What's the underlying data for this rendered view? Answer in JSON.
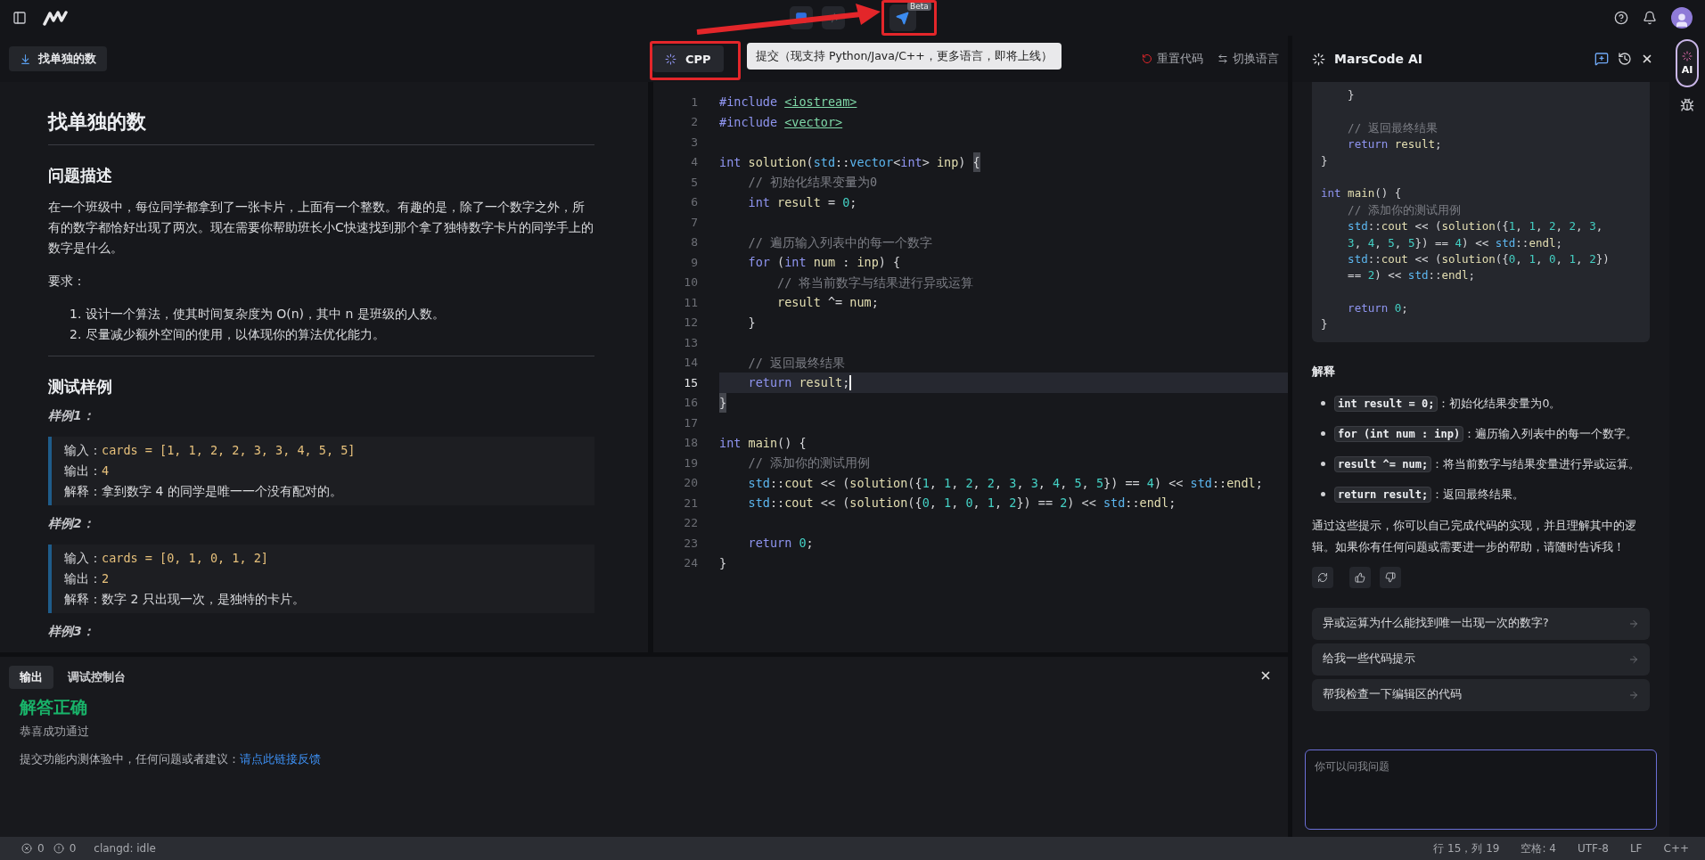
{
  "top_bar": {
    "submit_badge": "Beta"
  },
  "tooltip": {
    "text": "提交（现支持 Python/Java/C++，更多语言，即将上线）"
  },
  "problem_tab": {
    "label": "找单独的数"
  },
  "language_button": {
    "label": "CPP"
  },
  "editor_actions": [
    {
      "kind": "reset",
      "label": "重置代码"
    },
    {
      "kind": "switch",
      "label": "切换语言"
    }
  ],
  "problem": {
    "title": "找单独的数",
    "sections": [
      {
        "kind": "heading",
        "text": "问题描述"
      },
      {
        "kind": "paragraph",
        "text": "在一个班级中，每位同学都拿到了一张卡片，上面有一个整数。有趣的是，除了一个数字之外，所有的数字都恰好出现了两次。现在需要你帮助班长小C快速找到那个拿了独特数字卡片的同学手上的数字是什么。"
      },
      {
        "kind": "paragraph",
        "text": "要求："
      },
      {
        "kind": "list",
        "items": [
          {
            "number": "1.",
            "text": "设计一个算法，使其时间复杂度为 O(n)，其中 n 是班级的人数。"
          },
          {
            "number": "2.",
            "text": "尽量减少额外空间的使用，以体现你的算法优化能力。"
          }
        ]
      },
      {
        "kind": "rule"
      },
      {
        "kind": "heading",
        "text": "测试样例"
      },
      {
        "kind": "example_title",
        "text": "样例1："
      },
      {
        "kind": "example",
        "lines": [
          {
            "label": "输入：",
            "value": "cards = [1, 1, 2, 2, 3, 3, 4, 5, 5]",
            "code": true
          },
          {
            "label": "输出：",
            "value": "4",
            "code": true
          },
          {
            "label": "解释：",
            "value": "拿到数字 4 的同学是唯一一个没有配对的。",
            "code": false
          }
        ]
      },
      {
        "kind": "example_title",
        "text": "样例2："
      },
      {
        "kind": "example",
        "lines": [
          {
            "label": "输入：",
            "value": "cards = [0, 1, 0, 1, 2]",
            "code": true
          },
          {
            "label": "输出：",
            "value": "2",
            "code": true
          },
          {
            "label": "解释：",
            "value": "数字 2 只出现一次，是独特的卡片。",
            "code": false
          }
        ]
      },
      {
        "kind": "example_title",
        "text": "样例3："
      }
    ]
  },
  "editor": {
    "lines": [
      {
        "number": "1",
        "selected": false,
        "tokens": [
          {
            "kind": "pp",
            "text": "#include "
          },
          {
            "kind": "inc",
            "text": "<iostream>"
          }
        ]
      },
      {
        "number": "2",
        "selected": false,
        "tokens": [
          {
            "kind": "pp",
            "text": "#include "
          },
          {
            "kind": "inc",
            "text": "<vector>"
          }
        ]
      },
      {
        "number": "3",
        "selected": false
      },
      {
        "number": "4",
        "selected": false,
        "tokens": [
          {
            "kind": "kw",
            "text": "int"
          },
          {
            "kind": "id",
            "text": " solution"
          },
          {
            "kind": "p",
            "text": "("
          },
          {
            "kind": "ns",
            "text": "std"
          },
          {
            "kind": "p",
            "text": "::"
          },
          {
            "kind": "ns",
            "text": "vector"
          },
          {
            "kind": "p",
            "text": "<"
          },
          {
            "kind": "kw",
            "text": "int"
          },
          {
            "kind": "p",
            "text": ">"
          },
          {
            "kind": "id",
            "text": " inp"
          },
          {
            "kind": "p",
            "text": ") "
          },
          {
            "kind": "bm",
            "text": "{"
          }
        ]
      },
      {
        "number": "5",
        "selected": false,
        "tokens": [
          {
            "kind": "cm",
            "text": "    // 初始化结果变量为0"
          }
        ]
      },
      {
        "number": "6",
        "selected": false,
        "tokens": [
          {
            "kind": "kw",
            "text": "    int"
          },
          {
            "kind": "id",
            "text": " result"
          },
          {
            "kind": "p",
            "text": " = "
          },
          {
            "kind": "num",
            "text": "0"
          },
          {
            "kind": "p",
            "text": ";"
          }
        ]
      },
      {
        "number": "7",
        "selected": false
      },
      {
        "number": "8",
        "selected": false,
        "tokens": [
          {
            "kind": "cm",
            "text": "    // 遍历输入列表中的每一个数字"
          }
        ]
      },
      {
        "number": "9",
        "selected": false,
        "tokens": [
          {
            "kind": "kw",
            "text": "    for"
          },
          {
            "kind": "p",
            "text": " ("
          },
          {
            "kind": "kw",
            "text": "int"
          },
          {
            "kind": "id",
            "text": " num"
          },
          {
            "kind": "p",
            "text": " : "
          },
          {
            "kind": "id",
            "text": "inp"
          },
          {
            "kind": "p",
            "text": ") {"
          }
        ]
      },
      {
        "number": "10",
        "selected": false,
        "tokens": [
          {
            "kind": "cm",
            "text": "        // 将当前数字与结果进行异或运算"
          }
        ]
      },
      {
        "number": "11",
        "selected": false,
        "tokens": [
          {
            "kind": "id",
            "text": "        result"
          },
          {
            "kind": "p",
            "text": " ^= "
          },
          {
            "kind": "id",
            "text": "num"
          },
          {
            "kind": "p",
            "text": ";"
          }
        ]
      },
      {
        "number": "12",
        "selected": false,
        "tokens": [
          {
            "kind": "p",
            "text": "    }"
          }
        ]
      },
      {
        "number": "13",
        "selected": false
      },
      {
        "number": "14",
        "selected": false,
        "tokens": [
          {
            "kind": "cm",
            "text": "    // 返回最终结果"
          }
        ]
      },
      {
        "number": "15",
        "selected": true,
        "tokens": [
          {
            "kind": "kw",
            "text": "    return"
          },
          {
            "kind": "id",
            "text": " result"
          },
          {
            "kind": "p",
            "text": ";"
          }
        ]
      },
      {
        "number": "16",
        "selected": false,
        "tokens": [
          {
            "kind": "bm",
            "text": "}"
          }
        ]
      },
      {
        "number": "17",
        "selected": false
      },
      {
        "number": "18",
        "selected": false,
        "tokens": [
          {
            "kind": "kw",
            "text": "int"
          },
          {
            "kind": "id",
            "text": " main"
          },
          {
            "kind": "p",
            "text": "() {"
          }
        ]
      },
      {
        "number": "19",
        "selected": false,
        "tokens": [
          {
            "kind": "cm",
            "text": "    // 添加你的测试用例"
          }
        ]
      },
      {
        "number": "20",
        "selected": false,
        "tokens": [
          {
            "kind": "ns",
            "text": "    std"
          },
          {
            "kind": "p",
            "text": "::"
          },
          {
            "kind": "id",
            "text": "cout"
          },
          {
            "kind": "p",
            "text": " << ("
          },
          {
            "kind": "id",
            "text": "solution"
          },
          {
            "kind": "p",
            "text": "({"
          },
          {
            "kind": "num",
            "text": "1"
          },
          {
            "kind": "p",
            "text": ", "
          },
          {
            "kind": "num",
            "text": "1"
          },
          {
            "kind": "p",
            "text": ", "
          },
          {
            "kind": "num",
            "text": "2"
          },
          {
            "kind": "p",
            "text": ", "
          },
          {
            "kind": "num",
            "text": "2"
          },
          {
            "kind": "p",
            "text": ", "
          },
          {
            "kind": "num",
            "text": "3"
          },
          {
            "kind": "p",
            "text": ", "
          },
          {
            "kind": "num",
            "text": "3"
          },
          {
            "kind": "p",
            "text": ", "
          },
          {
            "kind": "num",
            "text": "4"
          },
          {
            "kind": "p",
            "text": ", "
          },
          {
            "kind": "num",
            "text": "5"
          },
          {
            "kind": "p",
            "text": ", "
          },
          {
            "kind": "num",
            "text": "5"
          },
          {
            "kind": "p",
            "text": "}) == "
          },
          {
            "kind": "num",
            "text": "4"
          },
          {
            "kind": "p",
            "text": ") << "
          },
          {
            "kind": "ns",
            "text": "std"
          },
          {
            "kind": "p",
            "text": "::"
          },
          {
            "kind": "id",
            "text": "endl"
          },
          {
            "kind": "p",
            "text": ";"
          }
        ]
      },
      {
        "number": "21",
        "selected": false,
        "tokens": [
          {
            "kind": "ns",
            "text": "    std"
          },
          {
            "kind": "p",
            "text": "::"
          },
          {
            "kind": "id",
            "text": "cout"
          },
          {
            "kind": "p",
            "text": " << ("
          },
          {
            "kind": "id",
            "text": "solution"
          },
          {
            "kind": "p",
            "text": "({"
          },
          {
            "kind": "num",
            "text": "0"
          },
          {
            "kind": "p",
            "text": ", "
          },
          {
            "kind": "num",
            "text": "1"
          },
          {
            "kind": "p",
            "text": ", "
          },
          {
            "kind": "num",
            "text": "0"
          },
          {
            "kind": "p",
            "text": ", "
          },
          {
            "kind": "num",
            "text": "1"
          },
          {
            "kind": "p",
            "text": ", "
          },
          {
            "kind": "num",
            "text": "2"
          },
          {
            "kind": "p",
            "text": "}) == "
          },
          {
            "kind": "num",
            "text": "2"
          },
          {
            "kind": "p",
            "text": ") << "
          },
          {
            "kind": "ns",
            "text": "std"
          },
          {
            "kind": "p",
            "text": "::"
          },
          {
            "kind": "id",
            "text": "endl"
          },
          {
            "kind": "p",
            "text": ";"
          }
        ]
      },
      {
        "number": "22",
        "selected": false
      },
      {
        "number": "23",
        "selected": false,
        "tokens": [
          {
            "kind": "kw",
            "text": "    return "
          },
          {
            "kind": "num",
            "text": "0"
          },
          {
            "kind": "p",
            "text": ";"
          }
        ]
      },
      {
        "number": "24",
        "selected": false,
        "tokens": [
          {
            "kind": "p",
            "text": "}"
          }
        ]
      }
    ]
  },
  "output": {
    "tabs": [
      {
        "label": "输出",
        "selected": true
      },
      {
        "label": "调试控制台",
        "selected": false
      }
    ],
    "result_title": "解答正确",
    "result_message": "恭喜成功通过",
    "feedback_text": "提交功能内测体验中，任何问题或者建议：",
    "feedback_link": "请点此链接反馈"
  },
  "ai_panel": {
    "title": "MarsCode AI",
    "code_groups": [
      [
        {
          "tokens": [
            {
              "kind": "p",
              "text": "    }"
            }
          ]
        }
      ],
      [
        {
          "tokens": [
            {
              "kind": "cm",
              "text": "    // 返回最终结果"
            }
          ]
        },
        {
          "tokens": [
            {
              "kind": "kw",
              "text": "    return"
            },
            {
              "kind": "id",
              "text": " result"
            },
            {
              "kind": "p",
              "text": ";"
            }
          ]
        },
        {
          "tokens": [
            {
              "kind": "p",
              "text": "}"
            }
          ]
        }
      ],
      [
        {
          "tokens": [
            {
              "kind": "kw",
              "text": "int"
            },
            {
              "kind": "id",
              "text": " main"
            },
            {
              "kind": "p",
              "text": "() {"
            }
          ]
        },
        {
          "tokens": [
            {
              "kind": "cm",
              "text": "    // 添加你的测试用例"
            }
          ]
        },
        {
          "tokens": [
            {
              "kind": "ns",
              "text": "    std"
            },
            {
              "kind": "p",
              "text": "::"
            },
            {
              "kind": "id",
              "text": "cout"
            },
            {
              "kind": "p",
              "text": " << ("
            },
            {
              "kind": "id",
              "text": "solution"
            },
            {
              "kind": "p",
              "text": "({"
            },
            {
              "kind": "num",
              "text": "1"
            },
            {
              "kind": "p",
              "text": ", "
            },
            {
              "kind": "num",
              "text": "1"
            },
            {
              "kind": "p",
              "text": ", "
            },
            {
              "kind": "num",
              "text": "2"
            },
            {
              "kind": "p",
              "text": ", "
            },
            {
              "kind": "num",
              "text": "2"
            },
            {
              "kind": "p",
              "text": ", "
            },
            {
              "kind": "num",
              "text": "3"
            },
            {
              "kind": "p",
              "text": ","
            }
          ]
        },
        {
          "tokens": [
            {
              "kind": "num",
              "text": "    3"
            },
            {
              "kind": "p",
              "text": ", "
            },
            {
              "kind": "num",
              "text": "4"
            },
            {
              "kind": "p",
              "text": ", "
            },
            {
              "kind": "num",
              "text": "5"
            },
            {
              "kind": "p",
              "text": ", "
            },
            {
              "kind": "num",
              "text": "5"
            },
            {
              "kind": "p",
              "text": "}) == "
            },
            {
              "kind": "num",
              "text": "4"
            },
            {
              "kind": "p",
              "text": ") << "
            },
            {
              "kind": "ns",
              "text": "std"
            },
            {
              "kind": "p",
              "text": "::"
            },
            {
              "kind": "id",
              "text": "endl"
            },
            {
              "kind": "p",
              "text": ";"
            }
          ]
        },
        {
          "tokens": [
            {
              "kind": "ns",
              "text": "    std"
            },
            {
              "kind": "p",
              "text": "::"
            },
            {
              "kind": "id",
              "text": "cout"
            },
            {
              "kind": "p",
              "text": " << ("
            },
            {
              "kind": "id",
              "text": "solution"
            },
            {
              "kind": "p",
              "text": "({"
            },
            {
              "kind": "num",
              "text": "0"
            },
            {
              "kind": "p",
              "text": ", "
            },
            {
              "kind": "num",
              "text": "1"
            },
            {
              "kind": "p",
              "text": ", "
            },
            {
              "kind": "num",
              "text": "0"
            },
            {
              "kind": "p",
              "text": ", "
            },
            {
              "kind": "num",
              "text": "1"
            },
            {
              "kind": "p",
              "text": ", "
            },
            {
              "kind": "num",
              "text": "2"
            },
            {
              "kind": "p",
              "text": "})"
            }
          ]
        },
        {
          "tokens": [
            {
              "kind": "p",
              "text": "    == "
            },
            {
              "kind": "num",
              "text": "2"
            },
            {
              "kind": "p",
              "text": ") << "
            },
            {
              "kind": "ns",
              "text": "std"
            },
            {
              "kind": "p",
              "text": "::"
            },
            {
              "kind": "id",
              "text": "endl"
            },
            {
              "kind": "p",
              "text": ";"
            }
          ]
        }
      ],
      [
        {
          "tokens": [
            {
              "kind": "kw",
              "text": "    return "
            },
            {
              "kind": "num",
              "text": "0"
            },
            {
              "kind": "p",
              "text": ";"
            }
          ]
        },
        {
          "tokens": [
            {
              "kind": "p",
              "text": "}"
            }
          ]
        }
      ]
    ],
    "explanation_title": "解释",
    "bullets": [
      {
        "code": "int result = 0;",
        "text": "：初始化结果变量为0。"
      },
      {
        "code": "for (int num : inp)",
        "text": "：遍历输入列表中的每一个数字。"
      },
      {
        "code": "result ^= num;",
        "text": "：将当前数字与结果变量进行异或运算。"
      },
      {
        "code": "return result;",
        "text": "：返回最终结果。"
      }
    ],
    "closing": "通过这些提示，你可以自己完成代码的实现，并且理解其中的逻辑。如果你有任何问题或需要进一步的帮助，请随时告诉我！",
    "suggestions": [
      "异或运算为什么能找到唯一出现一次的数字?",
      "给我一些代码提示",
      "帮我检查一下编辑区的代码"
    ],
    "input": {
      "placeholder": "你可以问我问题"
    }
  },
  "side_strip": {
    "ai_label": "AI",
    "ai_selected": true
  },
  "status_bar": {
    "errors": "0",
    "warnings": "0",
    "server": "clangd: idle",
    "items": [
      "行 15，列 19",
      "空格: 4",
      "UTF-8",
      "LF",
      "C++"
    ]
  }
}
